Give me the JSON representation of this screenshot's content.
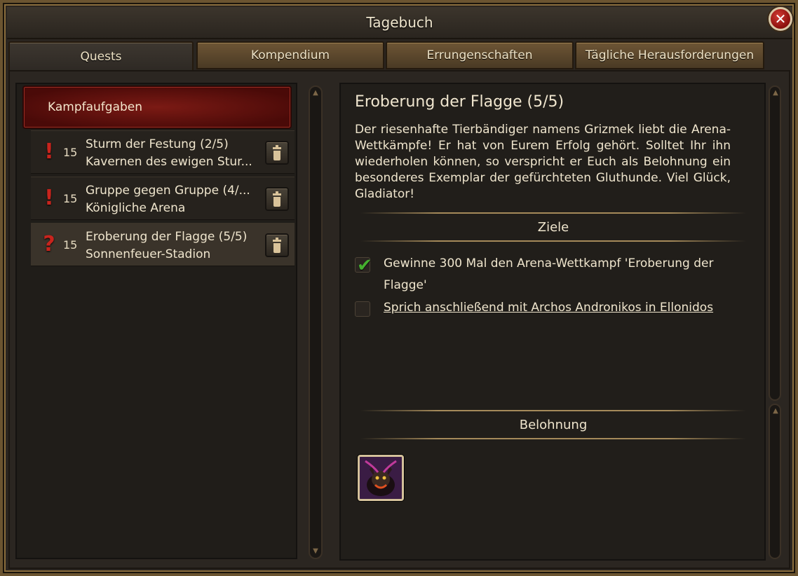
{
  "window": {
    "title": "Tagebuch",
    "close_label": "✕"
  },
  "tabs": [
    {
      "label": "Quests",
      "active": true
    },
    {
      "label": "Kompendium",
      "active": false
    },
    {
      "label": "Errungenschaften",
      "active": false
    },
    {
      "label": "Tägliche Herausforderungen",
      "active": false
    }
  ],
  "quest_list": {
    "category": "Kampfaufgaben",
    "items": [
      {
        "mark": "!",
        "level": "15",
        "title": "Sturm der Festung (2/5)",
        "location": "Kavernen des ewigen Stur...",
        "icon": "exclamation-icon"
      },
      {
        "mark": "!",
        "level": "15",
        "title": "Gruppe gegen Gruppe (4/...",
        "location": "Königliche Arena",
        "icon": "exclamation-icon"
      },
      {
        "mark": "?",
        "level": "15",
        "title": "Eroberung der Flagge (5/5)",
        "location": "Sonnenfeuer-Stadion",
        "icon": "question-icon"
      }
    ]
  },
  "quest_detail": {
    "title": "Eroberung der Flagge (5/5)",
    "description": "Der riesenhafte Tierbändiger namens Grizmek liebt die Arena-Wettkämpfe! Er hat von Eurem Erfolg gehört. Solltet Ihr ihn wiederholen können, so verspricht er Euch als Belohnung ein besonderes Exemplar der gefürchteten Gluthunde. Viel Glück, Gladiator!",
    "objectives_header": "Ziele",
    "objectives": [
      {
        "text": "Gewinne 300 Mal den Arena-Wettkampf 'Eroberung der Flagge'",
        "done": true
      },
      {
        "text": "Sprich anschließend mit Archos Andronikos in Ellonidos",
        "done": false
      }
    ],
    "reward_header": "Belohnung",
    "reward_icon": "gluthund-pet-icon"
  },
  "colors": {
    "accent_gold": "#a58a5a",
    "category_red": "#7b1a14",
    "check_green": "#45b02f",
    "mark_red": "#c8241d"
  }
}
